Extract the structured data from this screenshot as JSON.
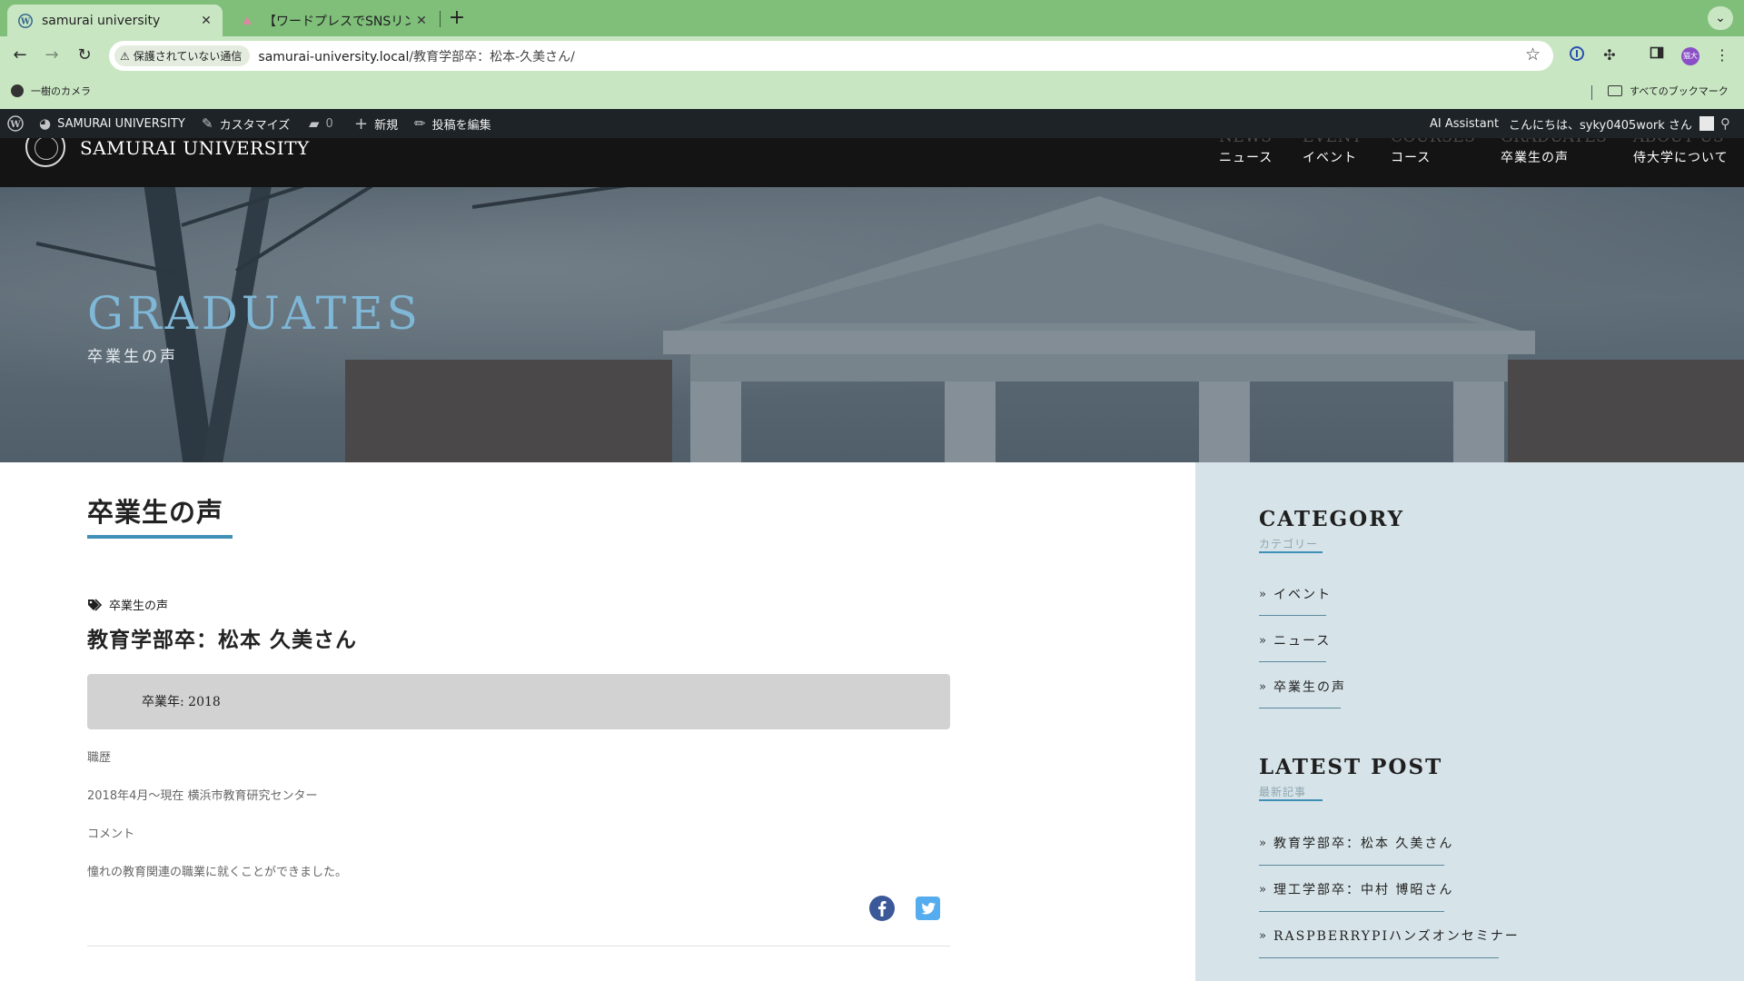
{
  "browser": {
    "tabs": [
      {
        "title": "samurai university",
        "active": true
      },
      {
        "title": "【ワードプレスでSNSリンクア…",
        "active": false
      }
    ],
    "address": {
      "security_label": "保護されていない通信",
      "host": "samurai-university.local",
      "path": "/教育学部卒：松本-久美さん/"
    },
    "profile_initials": "猫大",
    "bookmarks": {
      "items": [
        "一樹のカメラ"
      ],
      "all_bookmarks_label": "すべてのブックマーク"
    }
  },
  "admin_bar": {
    "site_name": "SAMURAI UNIVERSITY",
    "customize": "カスタマイズ",
    "comments_count": "0",
    "new_label": "新規",
    "edit_post": "投稿を編集",
    "ai_assistant": "AI Assistant",
    "greeting": "こんにちは、syky0405work さん"
  },
  "site": {
    "name": "SAMURAI UNIVERSITY",
    "nav": [
      {
        "en": "NEWS",
        "ja": "ニュース"
      },
      {
        "en": "EVENT",
        "ja": "イベント"
      },
      {
        "en": "COURSES",
        "ja": "コース"
      },
      {
        "en": "GRADUATES",
        "ja": "卒業生の声"
      },
      {
        "en": "ABOUT US",
        "ja": "侍大学について"
      }
    ]
  },
  "hero": {
    "title": "GRADUATES",
    "subtitle": "卒業生の声"
  },
  "article": {
    "page_title": "卒業生の声",
    "category": "卒業生の声",
    "post_title": "教育学部卒：松本 久美さん",
    "graduation_year": "卒業年: 2018",
    "career_label": "職歴",
    "career": "2018年4月～現在 横浜市教育研究センター",
    "comment_label": "コメント",
    "comment": "憧れの教育関連の職業に就くことができました。"
  },
  "sidebar": {
    "category": {
      "heading": "CATEGORY",
      "sub": "カテゴリー",
      "items": [
        "イベント",
        "ニュース",
        "卒業生の声"
      ]
    },
    "latest": {
      "heading": "LATEST POST",
      "sub": "最新記事",
      "items": [
        "教育学部卒：松本 久美さん",
        "理工学部卒：中村 博昭さん",
        "RASPBERRYPIハンズオンセミナー"
      ]
    }
  },
  "colors": {
    "accent": "#3f8fb7",
    "chrome_tabbar": "#7fbf7a",
    "chrome_toolbar": "#c9e6c3",
    "admin_bar": "#1d2327",
    "sidebar_bg": "#d6e3e8",
    "hero_title": "#7fb7d6",
    "facebook": "#3b5998",
    "twitter": "#55acee"
  },
  "icons": {
    "tab_favicon": "wordpress-icon",
    "back": "arrow-left-icon",
    "forward": "arrow-right-icon",
    "reload": "reload-icon",
    "bookmark": "star-icon",
    "share_facebook": "facebook-icon",
    "share_twitter": "twitter-icon"
  }
}
